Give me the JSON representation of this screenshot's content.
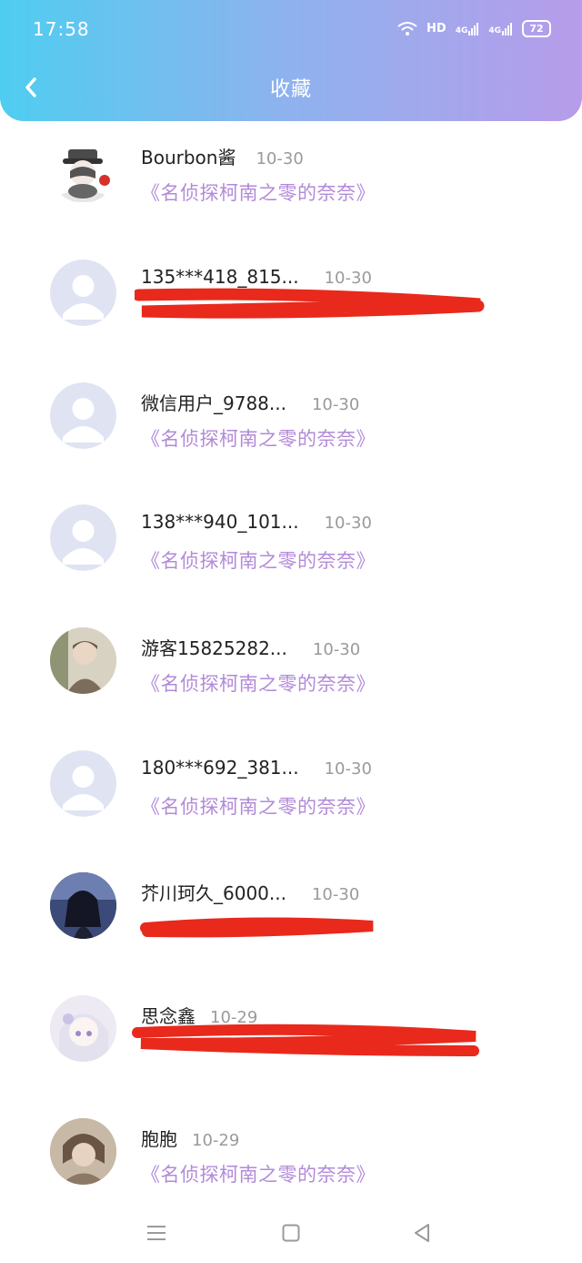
{
  "status_bar": {
    "time": "17:58",
    "network_hd": "HD",
    "signal1": "4G",
    "signal2": "4G",
    "battery": "72"
  },
  "header": {
    "title": "收藏",
    "back_icon": "chevron-left-icon"
  },
  "favorites": [
    {
      "name": "Bourbon酱",
      "date": "10-30",
      "work": "《名侦探柯南之零的奈奈》",
      "avatar": "custom"
    },
    {
      "name": "135***418_815...",
      "date": "10-30",
      "work": "",
      "avatar": "default"
    },
    {
      "name": "微信用户_9788...",
      "date": "10-30",
      "work": "《名侦探柯南之零的奈奈》",
      "avatar": "default"
    },
    {
      "name": "138***940_101...",
      "date": "10-30",
      "work": "《名侦探柯南之零的奈奈》",
      "avatar": "default"
    },
    {
      "name": "游客15825282...",
      "date": "10-30",
      "work": "《名侦探柯南之零的奈奈》",
      "avatar": "custom"
    },
    {
      "name": "180***692_381...",
      "date": "10-30",
      "work": "《名侦探柯南之零的奈奈》",
      "avatar": "default"
    },
    {
      "name": "芥川珂久_6000...",
      "date": "10-30",
      "work": "",
      "avatar": "custom"
    },
    {
      "name": "思念鑫",
      "date": "10-29",
      "work": "",
      "avatar": "custom"
    },
    {
      "name": "胞胞",
      "date": "10-29",
      "work": "《名侦探柯南之零的奈奈》",
      "avatar": "custom"
    }
  ],
  "nav_bar": {
    "menu_icon": "menu-icon",
    "home_icon": "home-square-icon",
    "back_icon": "back-triangle-icon"
  },
  "colors": {
    "header_gradient_start": "#4fcdf0",
    "header_gradient_end": "#b79cea",
    "link_purple": "#b28ad8",
    "redaction_red": "#e8291c"
  }
}
